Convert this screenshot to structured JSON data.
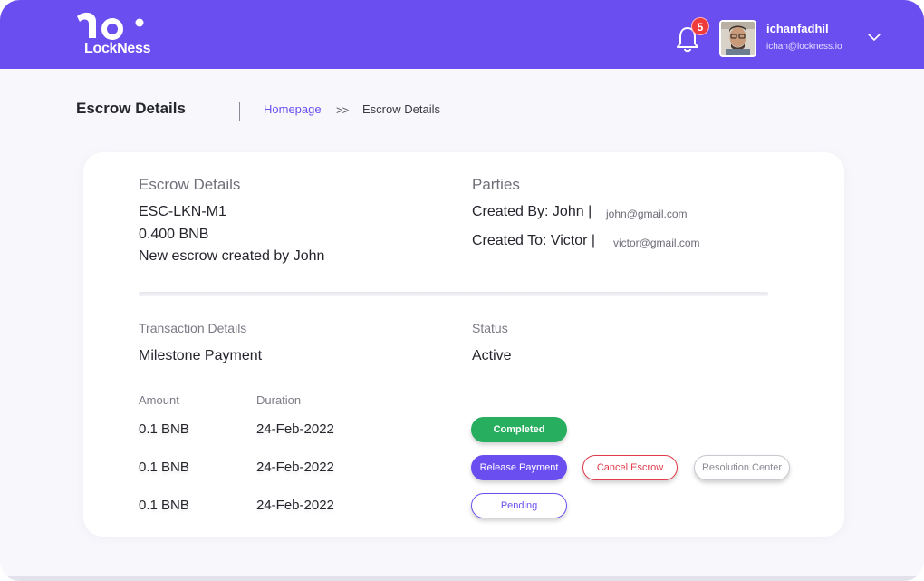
{
  "brand": {
    "logo_text": "LockNess",
    "accent": "#6a4ef0"
  },
  "topbar": {
    "notification_count": "5",
    "user_name": "ichanfadhil",
    "user_email": "ichan@lockness.io"
  },
  "header": {
    "title": "Escrow Details",
    "breadcrumb": {
      "home": "Homepage",
      "separator": ">>",
      "current": "Escrow Details"
    }
  },
  "escrow": {
    "section_title": "Escrow Details",
    "id": "ESC-LKN-M1",
    "amount": "0.400 BNB",
    "description": "New escrow created by John"
  },
  "parties": {
    "section_title": "Parties",
    "created_by_label": "Created By: John |",
    "created_by_email": "john@gmail.com",
    "created_to_label": "Created To: Victor |",
    "created_to_email": "victor@gmail.com"
  },
  "transaction": {
    "section_title": "Transaction Details",
    "type": "Milestone Payment",
    "status_title": "Status",
    "status": "Active",
    "columns": {
      "amount": "Amount",
      "duration": "Duration"
    },
    "rows": [
      {
        "amount": "0.1 BNB",
        "duration": "24-Feb-2022"
      },
      {
        "amount": "0.1 BNB",
        "duration": "24-Feb-2022"
      },
      {
        "amount": "0.1 BNB",
        "duration": "24-Feb-2022"
      }
    ]
  },
  "actions": {
    "completed": "Completed",
    "release_payment": "Release Payment",
    "cancel_escrow": "Cancel Escrow",
    "resolution_center": "Resolution Center",
    "pending": "Pending"
  },
  "colors": {
    "completed": "#27ae5f",
    "cancel": "#e03c4a",
    "badge": "#ee3b3b"
  }
}
